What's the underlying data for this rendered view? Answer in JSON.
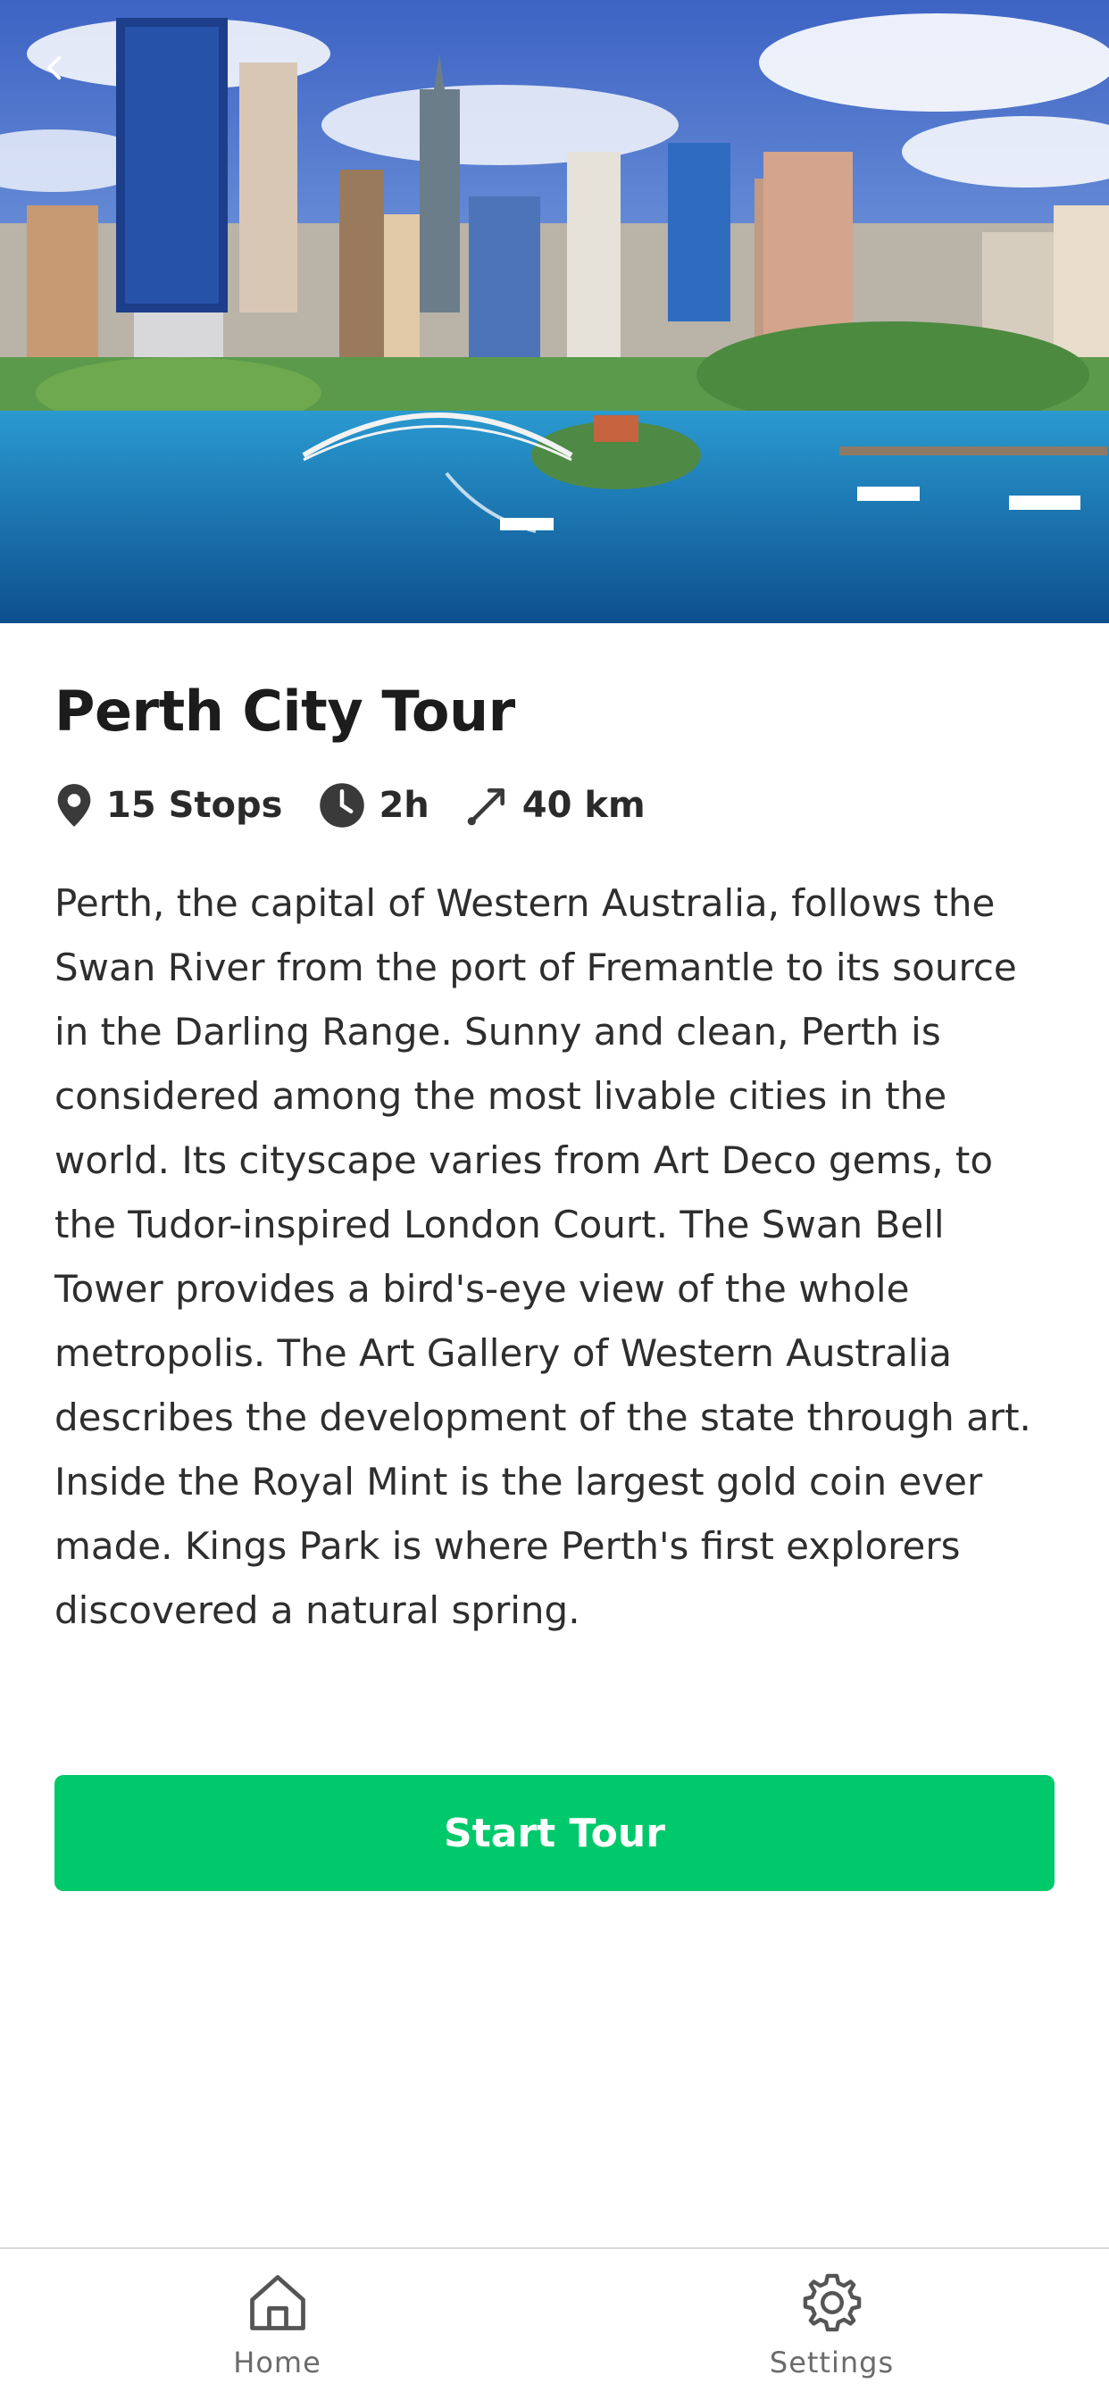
{
  "tour": {
    "title": "Perth City Tour",
    "stops": "15 Stops",
    "duration": "2h",
    "distance": "40 km",
    "description": "Perth, the capital of Western Australia, follows the Swan River from the port of Fremantle to its source in the Darling Range. Sunny and clean, Perth is considered among the most livable cities in the world. Its cityscape varies from Art Deco gems, to the Tudor-inspired London Court. The Swan Bell Tower provides a bird's-eye view of the whole metropolis. The Art Gallery of Western Australia describes the development of the state through art. Inside the Royal Mint is the largest gold coin ever made. Kings Park is where Perth's first explorers discovered a natural spring.",
    "start_label": "Start Tour"
  },
  "icons": {
    "back": "chevron-left-icon",
    "stops": "map-pin-icon",
    "duration": "clock-icon",
    "distance": "diagonal-arrow-icon",
    "home": "home-icon",
    "settings": "gear-icon"
  },
  "nav": {
    "items": [
      {
        "label": "Home"
      },
      {
        "label": "Settings"
      }
    ]
  },
  "colors": {
    "accent": "#00c96b",
    "text": "#222222",
    "muted": "#6b6b6b",
    "sky": "#4f7fd0",
    "water": "#1f77b8"
  }
}
